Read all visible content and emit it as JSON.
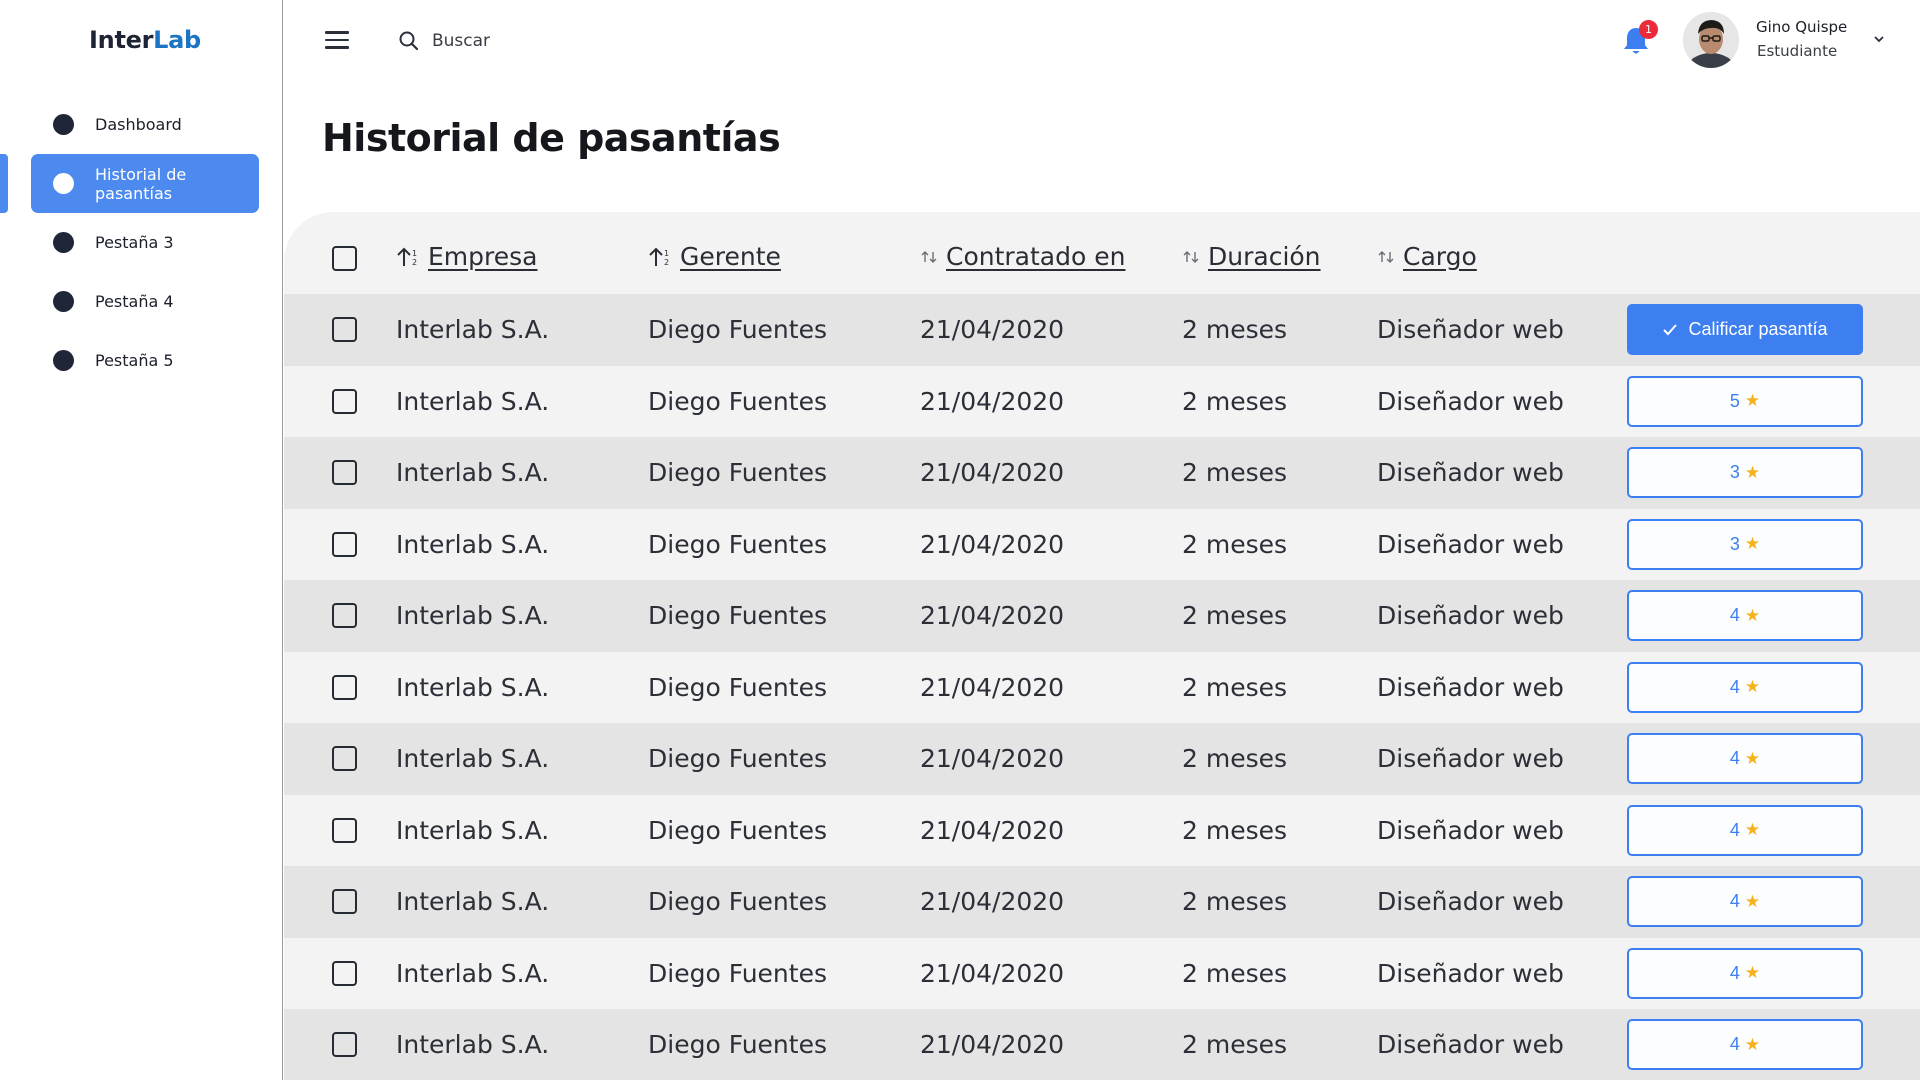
{
  "brand": {
    "part1": "Inter",
    "part2": "Lab"
  },
  "sidebar": {
    "items": [
      {
        "label": "Dashboard",
        "active": false
      },
      {
        "label": "Historial de pasantías",
        "active": true
      },
      {
        "label": "Pestaña 3",
        "active": false
      },
      {
        "label": "Pestaña 4",
        "active": false
      },
      {
        "label": "Pestaña 5",
        "active": false
      }
    ]
  },
  "header": {
    "search_placeholder": "Buscar",
    "notifications_count": "1",
    "user": {
      "name": "Gino Quispe",
      "role": "Estudiante"
    }
  },
  "page": {
    "title": "Historial de pasantías"
  },
  "table": {
    "columns": [
      "Empresa",
      "Gerente",
      "Contratado en",
      "Duración",
      "Cargo"
    ],
    "rate_button_label": "Calificar pasantía",
    "rows": [
      {
        "empresa": "Interlab S.A.",
        "gerente": "Diego Fuentes",
        "contratado": "21/04/2020",
        "duracion": "2 meses",
        "cargo": "Diseñador web",
        "rating": null
      },
      {
        "empresa": "Interlab S.A.",
        "gerente": "Diego Fuentes",
        "contratado": "21/04/2020",
        "duracion": "2 meses",
        "cargo": "Diseñador web",
        "rating": "5"
      },
      {
        "empresa": "Interlab S.A.",
        "gerente": "Diego Fuentes",
        "contratado": "21/04/2020",
        "duracion": "2 meses",
        "cargo": "Diseñador web",
        "rating": "3"
      },
      {
        "empresa": "Interlab S.A.",
        "gerente": "Diego Fuentes",
        "contratado": "21/04/2020",
        "duracion": "2 meses",
        "cargo": "Diseñador web",
        "rating": "3"
      },
      {
        "empresa": "Interlab S.A.",
        "gerente": "Diego Fuentes",
        "contratado": "21/04/2020",
        "duracion": "2 meses",
        "cargo": "Diseñador web",
        "rating": "4"
      },
      {
        "empresa": "Interlab S.A.",
        "gerente": "Diego Fuentes",
        "contratado": "21/04/2020",
        "duracion": "2 meses",
        "cargo": "Diseñador web",
        "rating": "4"
      },
      {
        "empresa": "Interlab S.A.",
        "gerente": "Diego Fuentes",
        "contratado": "21/04/2020",
        "duracion": "2 meses",
        "cargo": "Diseñador web",
        "rating": "4"
      },
      {
        "empresa": "Interlab S.A.",
        "gerente": "Diego Fuentes",
        "contratado": "21/04/2020",
        "duracion": "2 meses",
        "cargo": "Diseñador web",
        "rating": "4"
      },
      {
        "empresa": "Interlab S.A.",
        "gerente": "Diego Fuentes",
        "contratado": "21/04/2020",
        "duracion": "2 meses",
        "cargo": "Diseñador web",
        "rating": "4"
      },
      {
        "empresa": "Interlab S.A.",
        "gerente": "Diego Fuentes",
        "contratado": "21/04/2020",
        "duracion": "2 meses",
        "cargo": "Diseñador web",
        "rating": "4"
      },
      {
        "empresa": "Interlab S.A.",
        "gerente": "Diego Fuentes",
        "contratado": "21/04/2020",
        "duracion": "2 meses",
        "cargo": "Diseñador web",
        "rating": "4"
      }
    ]
  },
  "colors": {
    "accent": "#3d7ff0",
    "sidebar_active": "#4d8af0",
    "badge": "#ec2a3a",
    "star": "#f6b21a",
    "row_alt": "#e4e4e4"
  }
}
